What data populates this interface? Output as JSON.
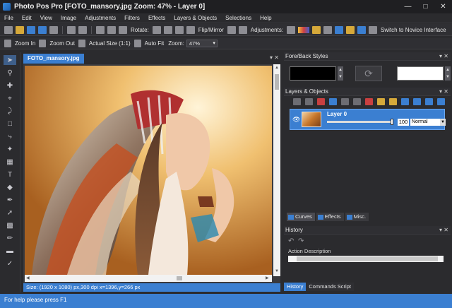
{
  "title": "Photo Pos Pro [FOTO_mansory.jpg Zoom: 47% - Layer 0]",
  "menus": [
    "File",
    "Edit",
    "View",
    "Image",
    "Adjustments",
    "Filters",
    "Effects",
    "Layers & Objects",
    "Selections",
    "Help"
  ],
  "toolbar1": {
    "rotate_label": "Rotate:",
    "flip_label": "Flip/Mirror",
    "adjust_label": "Adjustments:",
    "novice_label": "Switch to Novice Interface"
  },
  "toolbar2": {
    "zoom_in": "Zoom In",
    "zoom_out": "Zoom Out",
    "actual_size": "Actual Size (1:1)",
    "auto_fit": "Auto Fit",
    "zoom_label": "Zoom:",
    "zoom_value": "47%"
  },
  "document": {
    "tab": "FOTO_mansory.jpg",
    "status": "Size: (1920 x 1080) px,300 dpi   x=1396,y=266 px"
  },
  "forebackstyles": {
    "title": "Fore/Back Styles",
    "fore_color": "#000000",
    "back_color": "#ffffff"
  },
  "layers": {
    "title": "Layers & Objects",
    "layer_name": "Layer 0",
    "opacity": "100",
    "blend_mode": "Normal",
    "tabs": [
      "Curves",
      "Effects",
      "Misc."
    ]
  },
  "history": {
    "title": "History",
    "item": "Action Description",
    "tabs": [
      "History",
      "Commands Script"
    ]
  },
  "statusbar": "For help please press F1",
  "colors": {
    "accent": "#3b7fd1",
    "background": "#2b2b2e"
  }
}
